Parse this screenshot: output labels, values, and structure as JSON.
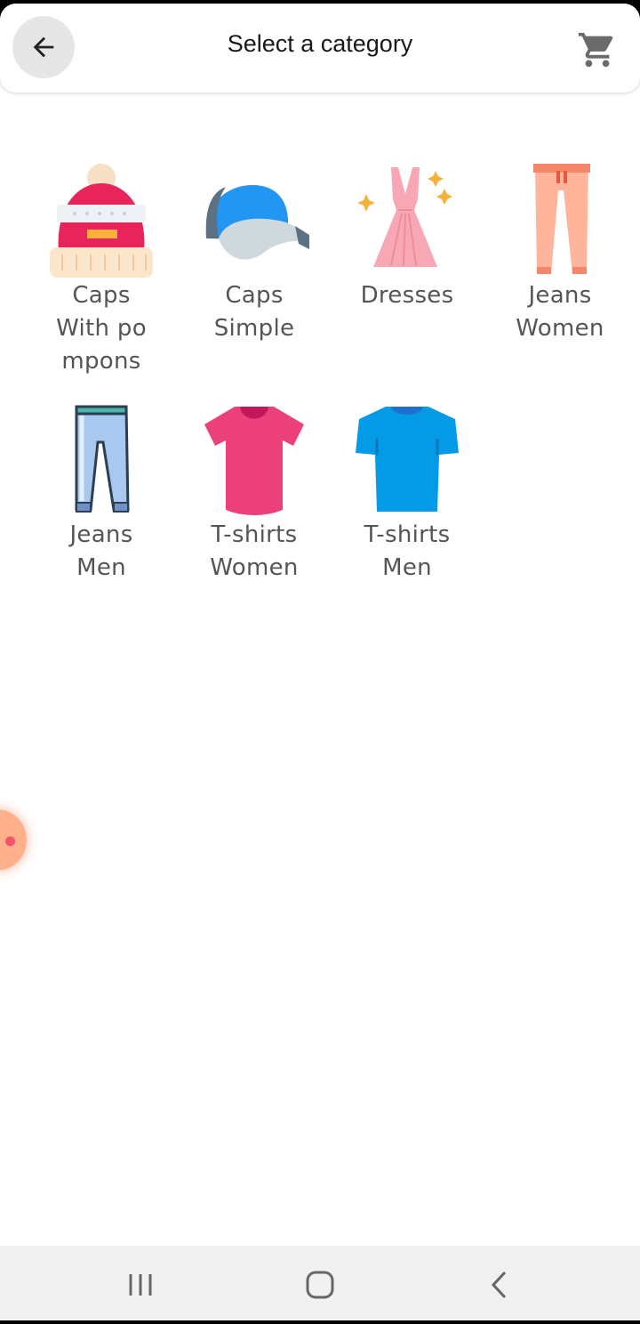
{
  "header": {
    "title": "Select a category",
    "back_icon": "arrow-left-icon",
    "cart_icon": "shopping-cart-icon"
  },
  "categories": [
    {
      "label": "Caps\nWith po\nmpons",
      "icon": "beanie-hat-icon"
    },
    {
      "label": "Caps\nSimple",
      "icon": "baseball-cap-icon"
    },
    {
      "label": "Dresses",
      "icon": "dress-icon"
    },
    {
      "label": "Jeans\nWomen",
      "icon": "women-pants-icon"
    },
    {
      "label": "Jeans\nMen",
      "icon": "men-jeans-icon"
    },
    {
      "label": "T-shirts\nWomen",
      "icon": "women-tshirt-icon"
    },
    {
      "label": "T-shirts\nMen",
      "icon": "men-tshirt-icon"
    }
  ],
  "floating_bubble_icon": "chat-head-icon",
  "system_nav": {
    "recents_icon": "recent-apps-icon",
    "home_icon": "home-icon",
    "back_icon": "system-back-icon"
  }
}
